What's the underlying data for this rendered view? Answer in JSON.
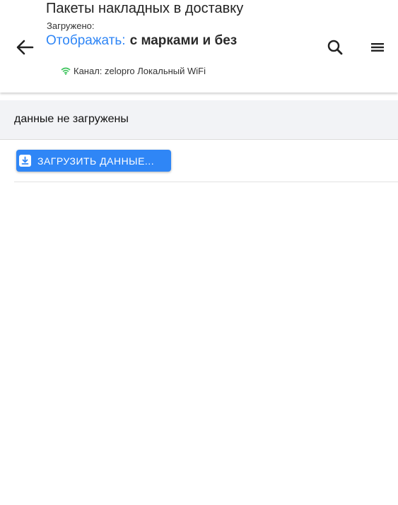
{
  "header": {
    "title": "Пакеты накладных в доставку",
    "loaded_label": "Загружено:",
    "display_label": "Отображать:",
    "display_value": "с марками и без",
    "channel_text": "Канал: zelopro Локальный WiFi"
  },
  "icons": {
    "back": "arrow-left-icon",
    "search": "search-icon",
    "menu": "hamburger-menu-icon",
    "wifi": "wifi-icon",
    "download": "download-icon"
  },
  "status": {
    "message": "данные не загружены"
  },
  "actions": {
    "load_label": "ЗАГРУЗИТЬ ДАННЫЕ..."
  },
  "colors": {
    "accent": "#2f86f6",
    "wifi": "#3bc35a",
    "status_bg": "#f2f3f6"
  }
}
